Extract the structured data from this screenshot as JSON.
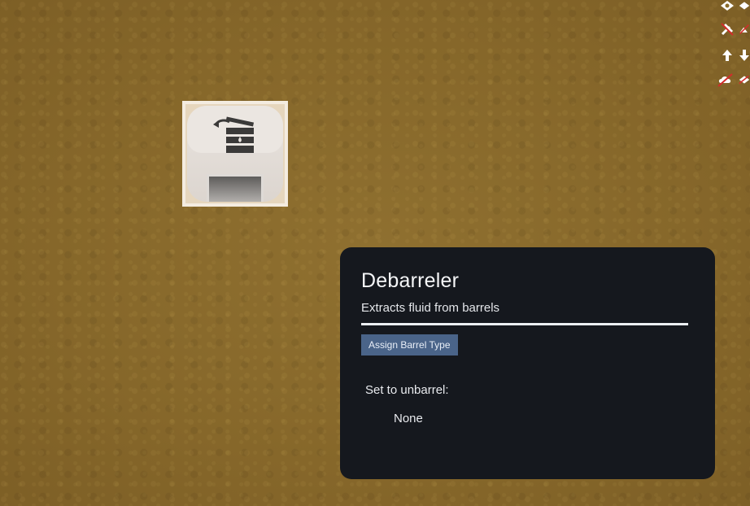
{
  "panel": {
    "title": "Debarreler",
    "description": "Extracts fluid from barrels",
    "assign_button_label": "Assign Barrel Type",
    "setting_label": "Set to unbarrel:",
    "setting_value": "None"
  },
  "building": {
    "icon": "debarreler-building-icon"
  },
  "toolbar": {
    "icons": [
      "view-icon",
      "visibility-icon",
      "tools-disabled-icon",
      "overlay-icon",
      "arrow-up-icon",
      "arrow-down-icon",
      "cloud-disabled-icon",
      "eye-disabled-icon"
    ]
  },
  "colors": {
    "panel_background": "#15181e",
    "button_background": "#4a6489",
    "ground": "#8a6b2a"
  }
}
